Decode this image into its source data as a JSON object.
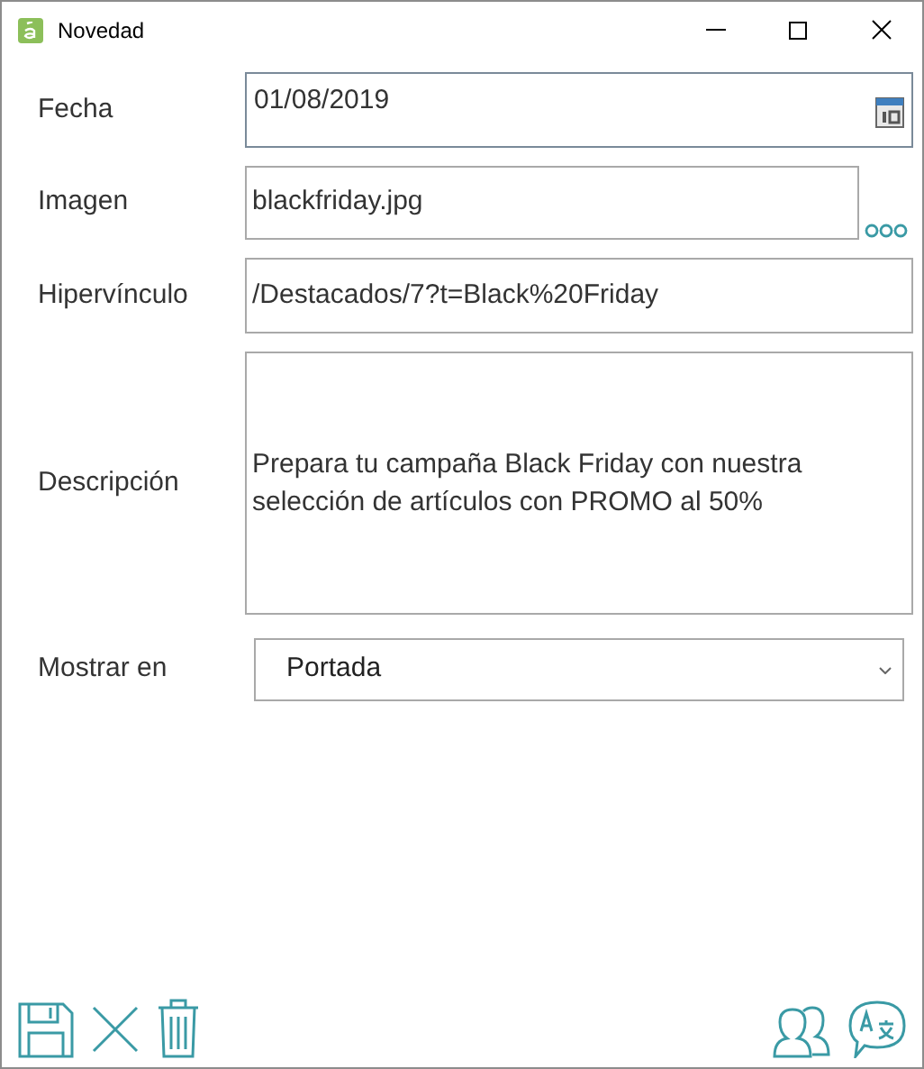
{
  "window": {
    "title": "Novedad"
  },
  "fields": [
    {
      "kind": "date",
      "label": "Fecha",
      "value": "01/08/2019"
    },
    {
      "kind": "file",
      "label": "Imagen",
      "value": "blackfriday.jpg"
    },
    {
      "kind": "text",
      "label": "Hipervínculo",
      "value": "/Destacados/7?t=Black%20Friday"
    },
    {
      "kind": "multiline",
      "label": "Descripción",
      "value": "Prepara tu campaña Black Friday con nuestra selección de artículos con PROMO al 50%"
    },
    {
      "kind": "select",
      "label": "Mostrar en",
      "value": "Portada"
    }
  ]
}
